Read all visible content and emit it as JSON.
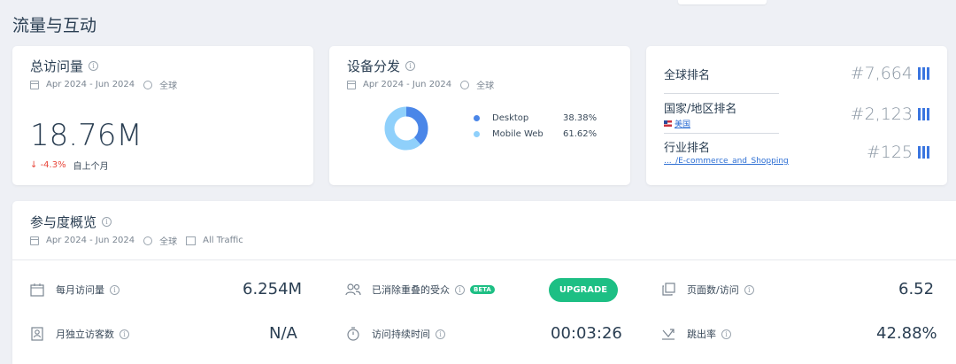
{
  "section_title": "流量与互动",
  "total_visits": {
    "title": "总访问量",
    "date_range": "Apr 2024 - Jun 2024",
    "region": "全球",
    "value": "18.76M",
    "change": "-4.3%",
    "change_label": "自上个月"
  },
  "device": {
    "title": "设备分发",
    "date_range": "Apr 2024 - Jun 2024",
    "region": "全球",
    "items": [
      {
        "label": "Desktop",
        "percent": "38.38%",
        "share": 38.38,
        "color": "#4a86e8"
      },
      {
        "label": "Mobile Web",
        "percent": "61.62%",
        "share": 61.62,
        "color": "#8fd0fb"
      }
    ]
  },
  "ranks": [
    {
      "label": "全球排名",
      "sub": "",
      "value": "#7,664"
    },
    {
      "label": "国家/地区排名",
      "sub": "美国",
      "value": "#2,123"
    },
    {
      "label": "行业排名",
      "sub": "..._/E-commerce_and_Shopping",
      "value": "#125"
    }
  ],
  "engagement": {
    "title": "参与度概览",
    "date_range": "Apr 2024 - Jun 2024",
    "region": "全球",
    "traffic": "All Traffic",
    "monthly_visits_label": "每月访问量",
    "monthly_visits_value": "6.254M",
    "dedup_label": "已消除重叠的受众",
    "beta": "BETA",
    "upgrade": "UPGRADE",
    "pages_label": "页面数/访问",
    "pages_value": "6.52",
    "unique_label": "月独立访客数",
    "unique_value": "N/A",
    "duration_label": "访问持续时间",
    "duration_value": "00:03:26",
    "bounce_label": "跳出率",
    "bounce_value": "42.88%"
  }
}
